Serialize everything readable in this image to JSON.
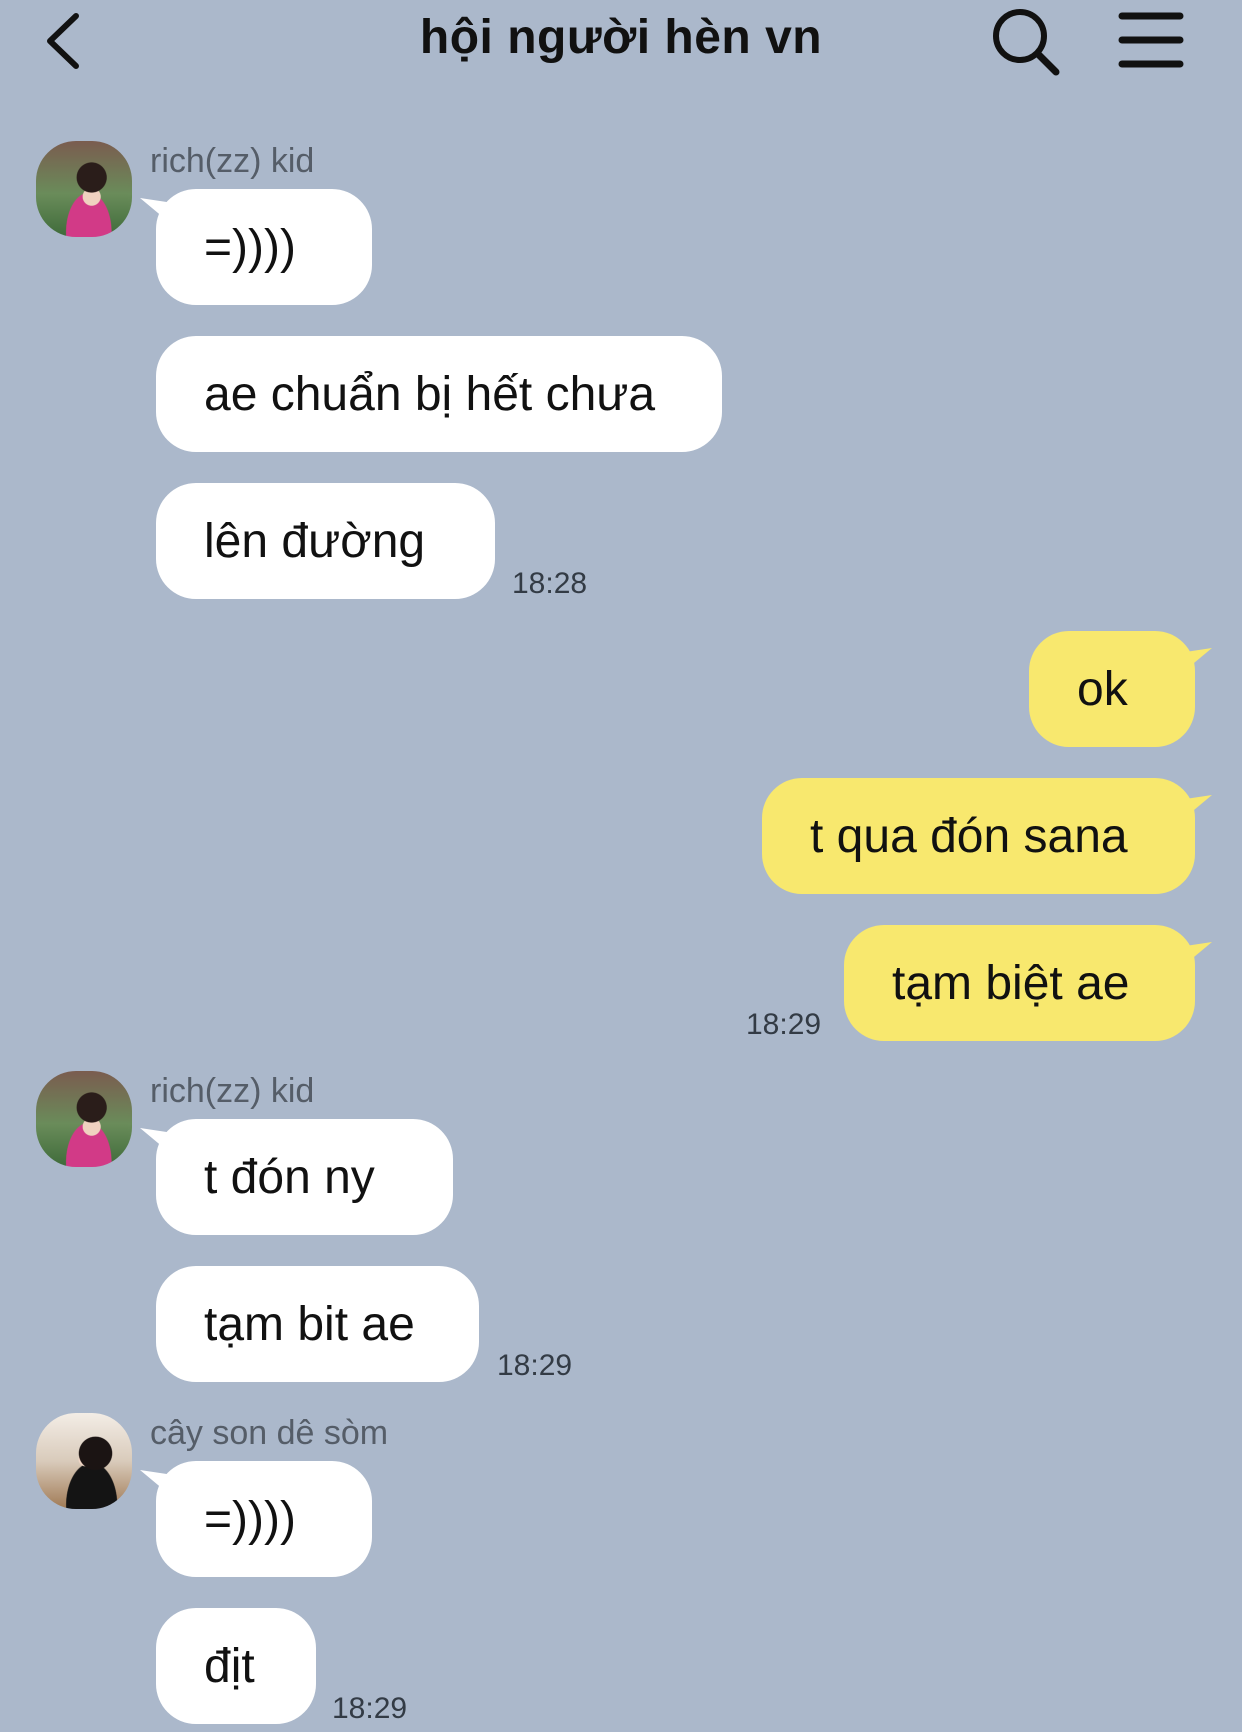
{
  "header": {
    "title": "hội người hèn vn",
    "icons": [
      "back-icon",
      "search-icon",
      "menu-icon"
    ]
  },
  "colors": {
    "background": "#abb8cb",
    "incoming_bubble": "#ffffff",
    "outgoing_bubble": "#f8e86e"
  },
  "messages": {
    "g1": {
      "sender": "rich(zz) kid",
      "texts": [
        "=))))",
        "ae chuẩn bị hết chưa",
        "lên đường"
      ],
      "time": "18:28"
    },
    "g2": {
      "sender": "",
      "texts": [
        "ok",
        "t qua đón sana",
        "tạm biệt ae"
      ],
      "time": "18:29"
    },
    "g3": {
      "sender": "rich(zz) kid",
      "texts": [
        "t đón ny",
        "tạm bit ae"
      ],
      "time": "18:29"
    },
    "g4": {
      "sender": "cây son dê sòm",
      "texts": [
        "=))))",
        "địt"
      ],
      "time": "18:29"
    }
  }
}
